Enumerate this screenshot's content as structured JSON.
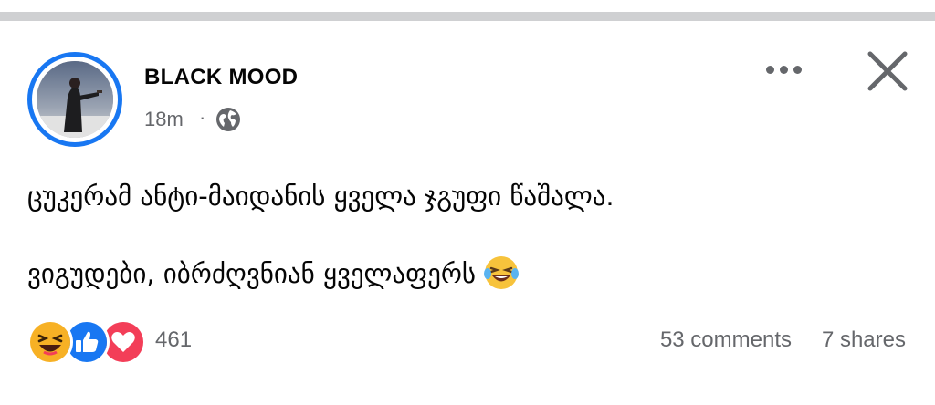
{
  "post": {
    "author": "BLACK MOOD",
    "time": "18m",
    "separator": "·",
    "privacy_icon": "globe-icon",
    "more_icon": "more-options-icon",
    "close_icon": "close-icon",
    "text_line_1": "ცუკერამ ანტი-მაიდანის ყველა ჯგუფი წაშალა.",
    "text_line_2": "ვიგუდები, იბრძღვნიან ყველაფერს",
    "text_emoji": "laughing-tears-emoji"
  },
  "footer": {
    "reaction_icons": [
      "haha-reaction-icon",
      "like-reaction-icon",
      "love-reaction-icon"
    ],
    "reaction_count": "461",
    "comments": "53 comments",
    "shares": "7 shares"
  },
  "colors": {
    "accent": "#1877f2",
    "secondary_text": "#65676b",
    "love": "#f33e58",
    "haha": "#f7b125"
  }
}
